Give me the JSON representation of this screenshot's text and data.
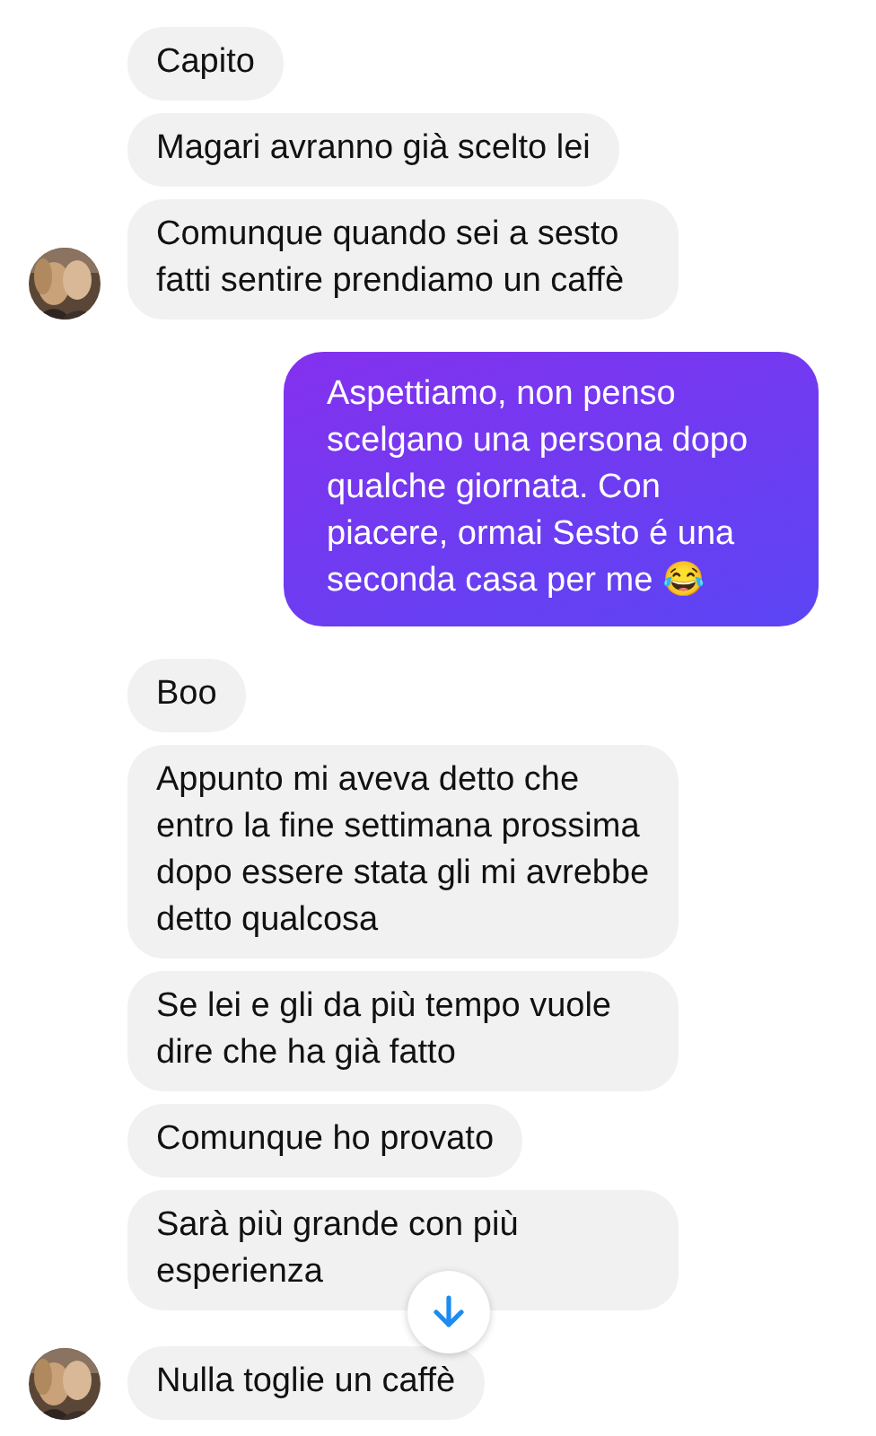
{
  "messages": [
    {
      "kind": "received",
      "text": "Capito",
      "avatar": false
    },
    {
      "kind": "received",
      "text": "Magari avranno già scelto lei",
      "avatar": false
    },
    {
      "kind": "received",
      "text": "Comunque quando sei a sesto fatti sentire prendiamo un caffè",
      "avatar": true
    },
    {
      "kind": "sent",
      "text": "Aspettiamo, non penso scelgano una persona dopo qualche giornata. Con piacere, ormai Sesto é una seconda casa per me 😂",
      "avatar": false
    },
    {
      "kind": "received",
      "text": "Boo",
      "avatar": false
    },
    {
      "kind": "received",
      "text": "Appunto mi aveva detto che entro la fine settimana prossima dopo essere stata gli mi avrebbe detto qualcosa",
      "avatar": false
    },
    {
      "kind": "received",
      "text": "Se lei e gli da più tempo vuole dire che ha già fatto",
      "avatar": false
    },
    {
      "kind": "received",
      "text": "Comunque ho provato",
      "avatar": false
    },
    {
      "kind": "received",
      "text": "Sarà più grande con più esperienza",
      "avatar": false
    },
    {
      "kind": "received",
      "text": "Nulla toglie un caffè",
      "avatar": true
    }
  ]
}
